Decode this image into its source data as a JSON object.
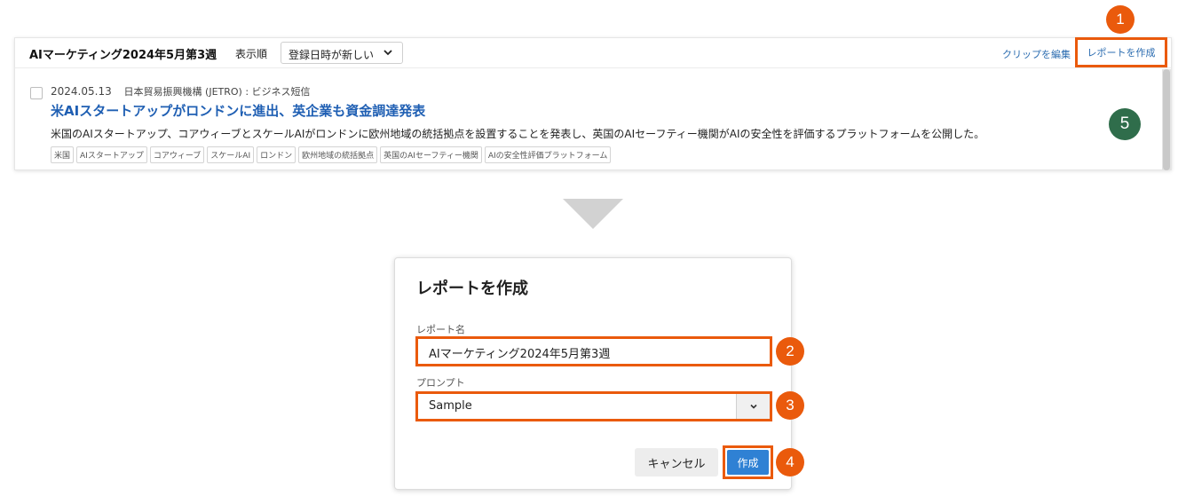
{
  "list_panel": {
    "report_title": "AIマーケティング2024年5月第3週",
    "sort_label": "表示順",
    "sort_value": "登録日時が新しい",
    "clip_edit_link": "クリップを編集",
    "create_report_link": "レポートを作成",
    "article": {
      "date": "2024.05.13",
      "source": "日本貿易振興機構 (JETRO) : ビジネス短信",
      "title": "米AIスタートアップがロンドンに進出、英企業も資金調達発表",
      "summary": "米国のAIスタートアップ、コアウィーブとスケールAIがロンドンに欧州地域の統括拠点を設置することを発表し、英国のAIセーフティー機関がAIの安全性を評価するプラットフォームを公開した。",
      "tags": [
        "米国",
        "AIスタートアップ",
        "コアウィーブ",
        "スケールAI",
        "ロンドン",
        "欧州地域の統括拠点",
        "英国のAIセーフティー機関",
        "AIの安全性評価プラットフォーム"
      ]
    }
  },
  "dialog": {
    "title": "レポートを作成",
    "name_label": "レポート名",
    "name_value": "AIマーケティング2024年5月第3週",
    "prompt_label": "プロンプト",
    "prompt_value": "Sample",
    "cancel_label": "キャンセル",
    "create_label": "作成"
  },
  "steps": {
    "s1": "1",
    "s2": "2",
    "s3": "3",
    "s4": "4",
    "s5": "5"
  },
  "colors": {
    "highlight": "#ea5a0c",
    "link": "#2b6cb0",
    "title_blue": "#1f5fb3",
    "primary_button": "#2f81d4",
    "badge_green": "#2f6d4b",
    "arrow": "#d2d2d2"
  },
  "icons": {
    "sort_chevron": "chevron-down-icon",
    "prompt_chevron": "chevron-down-icon",
    "step_arrow": "triangle-down-arrow"
  }
}
